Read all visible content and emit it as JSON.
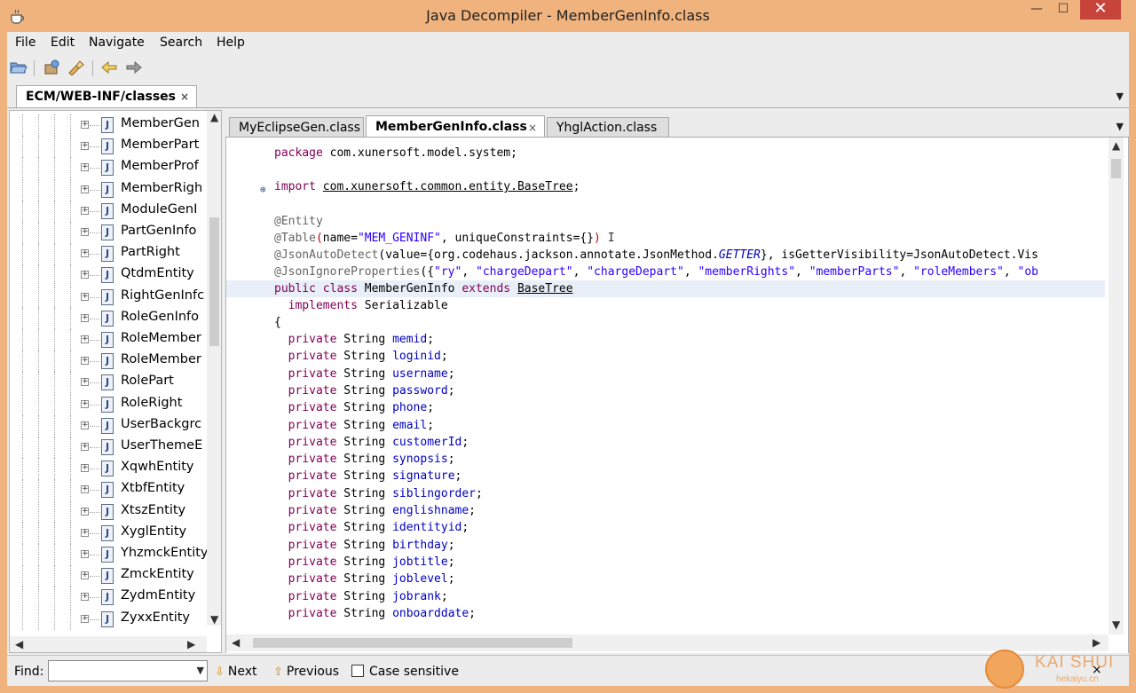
{
  "window": {
    "title": "Java Decompiler - MemberGenInfo.class",
    "minimize": "—",
    "maximize": "☐",
    "close": "✕"
  },
  "menu": [
    "File",
    "Edit",
    "Navigate",
    "Search",
    "Help"
  ],
  "outer_tab": {
    "label": "ECM/WEB-INF/classes",
    "close": "×"
  },
  "tree": {
    "items": [
      "MemberGen",
      "MemberPart",
      "MemberProf",
      "MemberRigh",
      "ModuleGenI",
      "PartGenInfo",
      "PartRight",
      "QtdmEntity",
      "RightGenInfc",
      "RoleGenInfo",
      "RoleMember",
      "RoleMember",
      "RolePart",
      "RoleRight",
      "UserBackgrc",
      "UserThemeE",
      "XqwhEntity",
      "XtbfEntity",
      "XtszEntity",
      "XyglEntity",
      "YhzmckEntity",
      "ZmckEntity",
      "ZydmEntity",
      "ZyxxEntity"
    ],
    "icon_letter": "J"
  },
  "editor_tabs": [
    {
      "label": "MyEclipseGen.class",
      "active": false
    },
    {
      "label": "MemberGenInfo.class",
      "active": true,
      "close": "×"
    },
    {
      "label": "YhglAction.class",
      "active": false
    }
  ],
  "code": {
    "package": [
      "package",
      " com.xunersoft.model.system;"
    ],
    "import": [
      "import",
      "com.xunersoft.common.entity.BaseTree",
      ";"
    ],
    "entity": "@Entity",
    "table": [
      "@Table",
      "(",
      "name=",
      "\"MEM_GENINF\"",
      ", uniqueConstraints={}",
      ")"
    ],
    "autodetect": [
      "@JsonAutoDetect",
      "(value={org.codehaus.jackson.annotate.JsonMethod.",
      "GETTER",
      "}, isGetterVisibility=JsonAutoDetect.Vis"
    ],
    "ignore": [
      "@JsonIgnoreProperties",
      "({",
      "\"ry\"",
      ", ",
      "\"chargeDepart\"",
      ", ",
      "\"chargeDepart\"",
      ", ",
      "\"memberRights\"",
      ", ",
      "\"memberParts\"",
      ", ",
      "\"roleMembers\"",
      ", ",
      "\"ob"
    ],
    "class_decl": [
      "public class",
      " MemberGenInfo ",
      "extends",
      " ",
      "BaseTree"
    ],
    "implements": [
      "implements",
      " Serializable"
    ],
    "brace": "{",
    "field_prefix": [
      "private",
      " String "
    ],
    "fields": [
      "memid",
      "loginid",
      "username",
      "password",
      "phone",
      "email",
      "customerId",
      "synopsis",
      "signature",
      "siblingorder",
      "englishname",
      "identityid",
      "birthday",
      "jobtitle",
      "joblevel",
      "jobrank",
      "onboarddate"
    ],
    "semicolon": ";"
  },
  "findbar": {
    "label": "Find:",
    "value": "",
    "next": "Next",
    "previous": "Previous",
    "case_sensitive": "Case sensitive",
    "close": "×"
  },
  "watermark": {
    "text": "KAI SHUI",
    "sub": "hekaiyu.cn"
  },
  "colors": {
    "titlebar": "#f0b37e",
    "close_button": "#c7443b",
    "keyword": "#7f0055",
    "string": "#2a00ff",
    "field": "#0000c0"
  }
}
